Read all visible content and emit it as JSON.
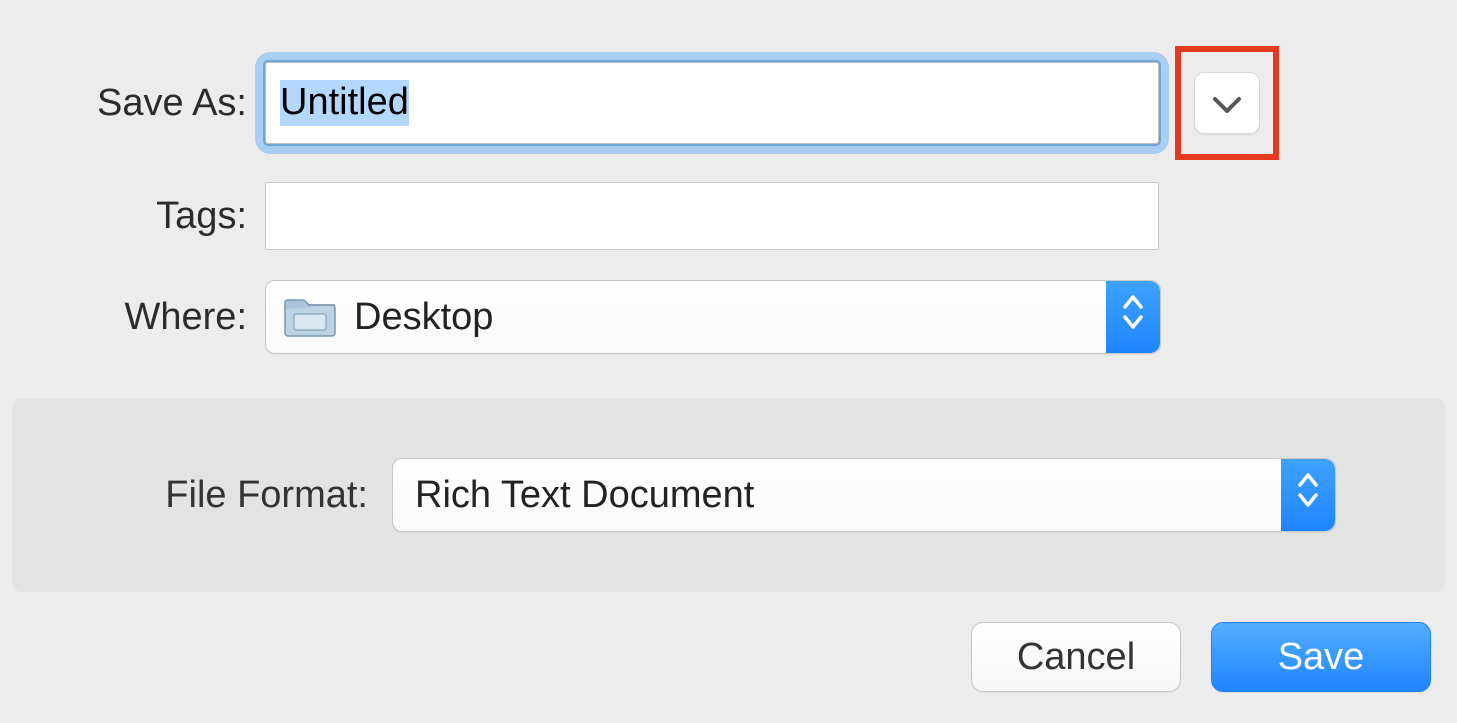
{
  "labels": {
    "save_as": "Save As:",
    "tags": "Tags:",
    "where": "Where:",
    "file_format": "File Format:"
  },
  "fields": {
    "save_as_value": "Untitled",
    "tags_value": "",
    "where_value": "Desktop",
    "file_format_value": "Rich Text Document"
  },
  "buttons": {
    "cancel": "Cancel",
    "save": "Save"
  },
  "icons": {
    "expand": "chevron-down-icon",
    "folder": "folder-icon",
    "stepper": "up-down-icon"
  },
  "colors": {
    "accent_blue": "#2a8cff",
    "focus_ring": "#a9cef1",
    "highlight_box": "#e53a1f",
    "panel_bg": "#e3e3e3"
  }
}
